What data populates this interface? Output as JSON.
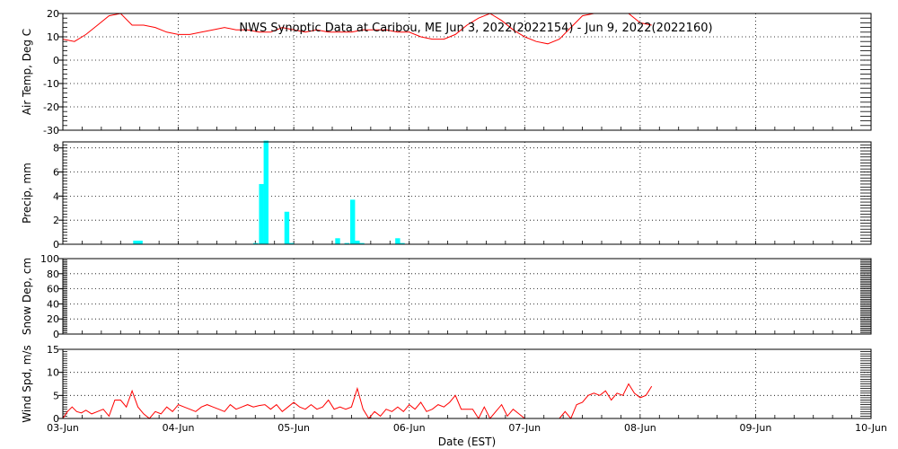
{
  "title": "NWS Synoptic Data at Caribou, ME   Jun  3, 2022(2022154) - Jun  9, 2022(2022160)",
  "xlabel": "Date (EST)",
  "x_ticks": [
    "03-Jun",
    "04-Jun",
    "05-Jun",
    "06-Jun",
    "07-Jun",
    "08-Jun",
    "09-Jun",
    "10-Jun"
  ],
  "colors": {
    "temp": "#ff0000",
    "precip": "#00ffff",
    "wind": "#ff0000",
    "grid": "#000000"
  },
  "chart_data": [
    {
      "type": "line",
      "ylabel": "Air Temp, Deg C",
      "ylim": [
        -30,
        20
      ],
      "y_ticks": [
        -30,
        -20,
        -10,
        0,
        10,
        20
      ],
      "xlim": [
        0,
        7
      ],
      "grid": true,
      "series": [
        {
          "x": [
            0.0,
            0.1,
            0.2,
            0.3,
            0.4,
            0.5,
            0.6,
            0.7,
            0.8,
            0.9,
            1.0,
            1.1,
            1.2,
            1.3,
            1.4,
            1.5,
            1.6,
            1.7,
            1.8,
            1.9,
            2.0,
            2.1,
            2.2,
            2.3,
            2.4,
            2.5,
            2.6,
            2.7,
            2.8,
            2.9,
            3.0,
            3.1,
            3.2,
            3.3,
            3.4,
            3.5,
            3.6,
            3.7,
            3.8,
            3.9,
            4.0,
            4.1,
            4.2,
            4.3,
            4.4,
            4.5,
            4.6,
            4.7,
            4.8,
            4.9,
            5.0,
            5.1
          ],
          "y": [
            9,
            8,
            11,
            15,
            19,
            20,
            15,
            15,
            14,
            12,
            11,
            11,
            12,
            13,
            14,
            13,
            13,
            12,
            12,
            14,
            13,
            12,
            13,
            12,
            12,
            12,
            13,
            13,
            13,
            12,
            12,
            10,
            9,
            9,
            11,
            15,
            18,
            20,
            17,
            13,
            10,
            8,
            7,
            9,
            14,
            19,
            22,
            24,
            23,
            20,
            16,
            15
          ]
        }
      ]
    },
    {
      "type": "bar",
      "ylabel": "Precip, mm",
      "ylim": [
        0,
        8.5
      ],
      "y_ticks": [
        0,
        2,
        4,
        6,
        8
      ],
      "xlim": [
        0,
        7
      ],
      "grid": true,
      "bar_width": 0.042,
      "series": [
        {
          "x": [
            0.63,
            0.67,
            1.67,
            1.72,
            1.76,
            1.94,
            1.98,
            2.38,
            2.46,
            2.51,
            2.55,
            2.59,
            2.9,
            2.94
          ],
          "y": [
            0.3,
            0.3,
            0.1,
            5.0,
            8.6,
            2.7,
            0.1,
            0.5,
            0.1,
            3.7,
            0.3,
            0.1,
            0.5,
            0.1
          ]
        }
      ]
    },
    {
      "type": "line",
      "ylabel": "Snow Dep, cm",
      "ylim": [
        0,
        100
      ],
      "y_ticks": [
        0,
        20,
        40,
        60,
        80,
        100
      ],
      "xlim": [
        0,
        7
      ],
      "grid": true,
      "series": []
    },
    {
      "type": "line",
      "ylabel": "Wind Spd, m/s",
      "ylim": [
        0,
        15
      ],
      "y_ticks": [
        0,
        5,
        10,
        15
      ],
      "xlim": [
        0,
        7
      ],
      "grid": true,
      "series": [
        {
          "segments": [
            {
              "x": [
                0.0,
                0.04,
                0.08,
                0.12,
                0.16,
                0.2,
                0.25,
                0.3,
                0.35,
                0.4,
                0.45,
                0.5,
                0.55,
                0.6,
                0.65,
                0.7,
                0.75,
                0.8,
                0.85,
                0.9,
                0.95,
                1.0,
                1.05,
                1.1,
                1.15,
                1.2,
                1.25,
                1.3,
                1.35,
                1.4,
                1.45,
                1.5,
                1.55,
                1.6,
                1.65,
                1.7,
                1.75,
                1.8,
                1.85,
                1.9,
                1.95,
                2.0,
                2.05,
                2.1,
                2.15,
                2.2,
                2.25,
                2.3,
                2.35,
                2.4,
                2.45,
                2.5,
                2.55,
                2.6,
                2.65,
                2.7,
                2.75,
                2.8,
                2.85,
                2.9,
                2.95,
                3.0,
                3.05,
                3.1,
                3.15,
                3.2,
                3.25,
                3.3,
                3.35,
                3.4,
                3.45,
                3.5,
                3.55,
                3.6,
                3.65,
                3.7,
                3.75,
                3.8,
                3.85,
                3.9,
                3.95,
                4.0
              ],
              "y": [
                0,
                1.5,
                2.5,
                1.5,
                1.2,
                1.8,
                1.0,
                1.5,
                2.0,
                0.5,
                4.0,
                4.0,
                2.5,
                6.0,
                2.5,
                1.0,
                0,
                1.5,
                1.0,
                2.5,
                1.5,
                3.0,
                2.5,
                2.0,
                1.5,
                2.5,
                3.0,
                2.5,
                2.0,
                1.5,
                3.0,
                2.0,
                2.5,
                3.0,
                2.5,
                2.8,
                3.0,
                2.0,
                3.0,
                1.5,
                2.5,
                3.5,
                2.5,
                2.0,
                3.0,
                2.0,
                2.5,
                4.0,
                2.0,
                2.5,
                2.0,
                2.5,
                6.5,
                2.0,
                0,
                1.5,
                0.5,
                2.0,
                1.5,
                2.5,
                1.5,
                3.0,
                2.0,
                3.5,
                1.5,
                2.0,
                3.0,
                2.5,
                3.5,
                5.0,
                2.0,
                2.0,
                2.0,
                0,
                2.5,
                0,
                1.5,
                3.0,
                0.5,
                2.0,
                1.0,
                0
              ]
            },
            {
              "x": [
                4.3,
                4.35,
                4.4,
                4.45,
                4.5,
                4.55,
                4.6,
                4.65,
                4.7,
                4.75,
                4.8,
                4.85,
                4.9,
                4.95,
                5.0,
                5.05,
                5.1
              ],
              "y": [
                0,
                1.5,
                0,
                3.0,
                3.5,
                5.0,
                5.5,
                5.0,
                6.0,
                4.0,
                5.5,
                5.0,
                7.5,
                5.5,
                4.5,
                5.0,
                7.0
              ]
            }
          ]
        }
      ]
    }
  ]
}
